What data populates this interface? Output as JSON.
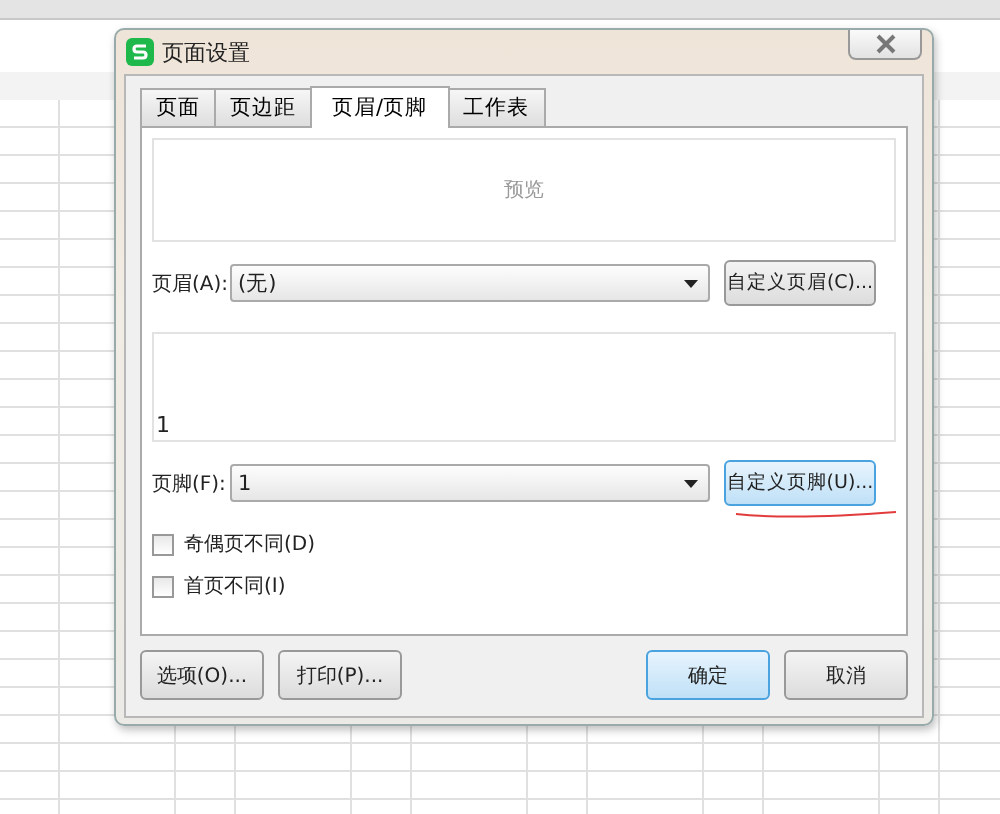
{
  "dialog": {
    "title": "页面设置"
  },
  "tabs": [
    {
      "label": "页面",
      "selected": false
    },
    {
      "label": "页边距",
      "selected": false
    },
    {
      "label": "页眉/页脚",
      "selected": true
    },
    {
      "label": "工作表",
      "selected": false
    }
  ],
  "header_preview": {
    "label": "预览"
  },
  "header": {
    "label": "页眉(A):",
    "value": "(无)",
    "button": {
      "label": "自定义页眉(C)...",
      "highlighted": false
    }
  },
  "footer_preview": {
    "text": "1"
  },
  "footer": {
    "label": "页脚(F):",
    "value": "1",
    "button": {
      "label": "自定义页脚(U)...",
      "highlighted": true
    }
  },
  "checkboxes": [
    {
      "label": "奇偶页不同(D)",
      "checked": false
    },
    {
      "label": "首页不同(I)",
      "checked": false
    }
  ],
  "buttons": [
    {
      "label": "选项(O)...",
      "highlighted": false
    },
    {
      "label": "打印(P)...",
      "highlighted": false
    },
    {
      "label": "确定",
      "highlighted": true
    },
    {
      "label": "取消",
      "highlighted": false
    }
  ]
}
